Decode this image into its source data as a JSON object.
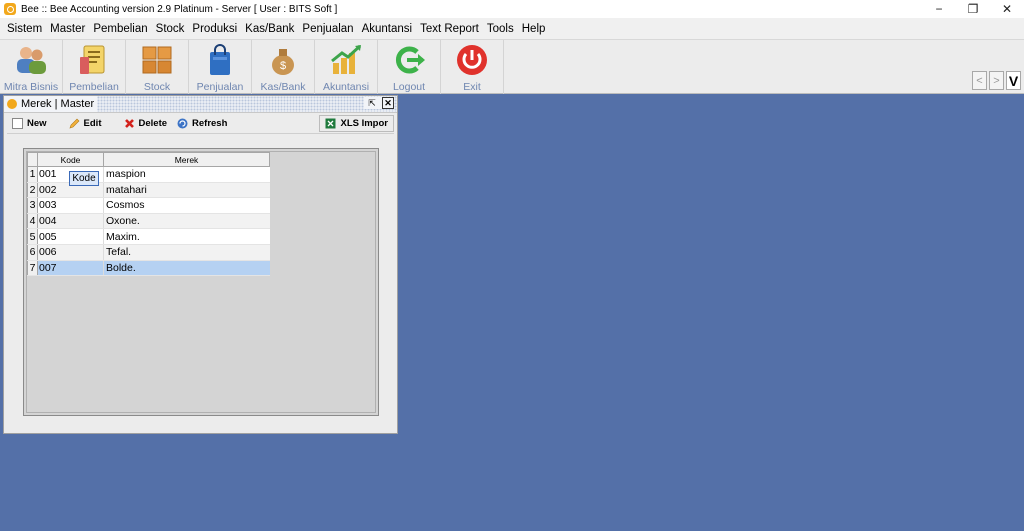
{
  "window": {
    "title": "Bee :: Bee Accounting version 2.9 Platinum - Server  [ User : BITS Soft ]",
    "controls": [
      "−",
      "❐",
      "✕"
    ]
  },
  "menu": [
    {
      "label": "Sistem"
    },
    {
      "label": "Master"
    },
    {
      "label": "Pembelian"
    },
    {
      "label": "Stock"
    },
    {
      "label": "Produksi"
    },
    {
      "label": "Kas/Bank"
    },
    {
      "label": "Penjualan"
    },
    {
      "label": "Akuntansi"
    },
    {
      "label": "Text Report"
    },
    {
      "label": "Tools"
    },
    {
      "label": "Help"
    }
  ],
  "toolbar": [
    {
      "label": "Mitra Bisnis",
      "icon": "partners-icon"
    },
    {
      "label": "Pembelian",
      "icon": "purchase-icon"
    },
    {
      "label": "Stock",
      "icon": "stock-boxes-icon"
    },
    {
      "label": "Penjualan",
      "icon": "shopping-bag-icon"
    },
    {
      "label": "Kas/Bank",
      "icon": "money-bag-icon"
    },
    {
      "label": "Akuntansi",
      "icon": "accounting-chart-icon"
    },
    {
      "label": "Logout",
      "icon": "logout-icon"
    },
    {
      "label": "Exit",
      "icon": "power-icon"
    }
  ],
  "toolbar_nav": {
    "prev": "<",
    "next": ">",
    "v": "V"
  },
  "child_window": {
    "title": "Merek | Master",
    "buttons": {
      "new": "New",
      "edit": "Edit",
      "delete": "Delete",
      "refresh": "Refresh",
      "xls": "XLS Impor"
    },
    "grid": {
      "columns": [
        "Kode",
        "Merek"
      ],
      "rows": [
        {
          "n": "1",
          "kode": "001",
          "merek": "maspion"
        },
        {
          "n": "2",
          "kode": "002",
          "merek": "matahari"
        },
        {
          "n": "3",
          "kode": "003",
          "merek": "Cosmos"
        },
        {
          "n": "4",
          "kode": "004",
          "merek": "Oxone."
        },
        {
          "n": "5",
          "kode": "005",
          "merek": "Maxim."
        },
        {
          "n": "6",
          "kode": "006",
          "merek": "Tefal."
        },
        {
          "n": "7",
          "kode": "007",
          "merek": "Bolde."
        }
      ],
      "selected_row": 7,
      "tooltip": "Kode"
    }
  }
}
